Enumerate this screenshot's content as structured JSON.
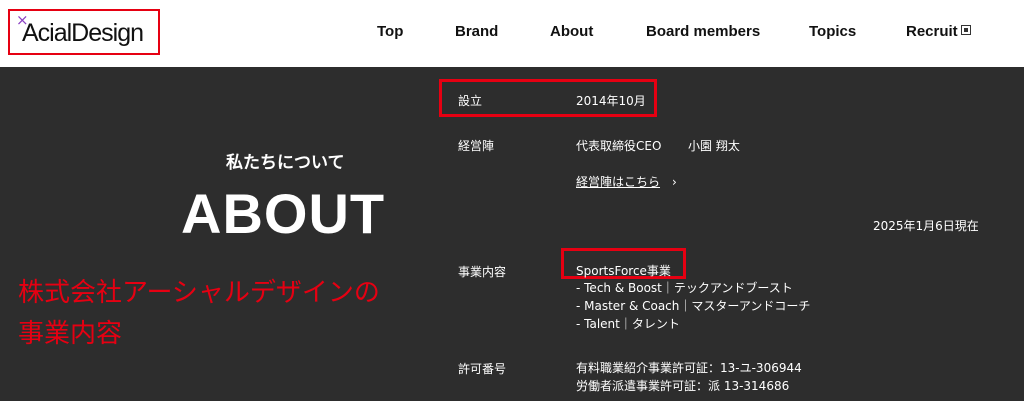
{
  "header": {
    "logo_text": "AcialDesign",
    "logo_mark": "×",
    "nav": [
      {
        "label": "Top"
      },
      {
        "label": "Brand"
      },
      {
        "label": "About"
      },
      {
        "label": "Board members"
      },
      {
        "label": "Topics"
      },
      {
        "label": "Recruit"
      }
    ]
  },
  "hero": {
    "subtitle": "私たちについて",
    "title": "ABOUT",
    "caption_line1": "株式会社アーシャルデザインの",
    "caption_line2": "事業内容"
  },
  "info": {
    "founded": {
      "label": "設立",
      "value": "2014年10月"
    },
    "management": {
      "label": "経営陣",
      "role": "代表取締役CEO",
      "name": "小園 翔太",
      "link": "経営陣はこちら",
      "chevron": "›"
    },
    "as_of": "2025年1月6日現在",
    "business": {
      "label": "事業内容",
      "heading": "SportsForce事業",
      "items": [
        "- Tech & Boost｜テックアンドブースト",
        "- Master & Coach｜マスターアンドコーチ",
        "- Talent｜タレント"
      ]
    },
    "license": {
      "label": "許可番号",
      "lines": [
        "有料職業紹介事業許可証：13-ユ-306944",
        "労働者派遣事業許可証：派 13-314686"
      ]
    }
  },
  "colors": {
    "highlight": "#e60012",
    "background": "#2d2d2d",
    "header_bg": "#ffffff"
  }
}
